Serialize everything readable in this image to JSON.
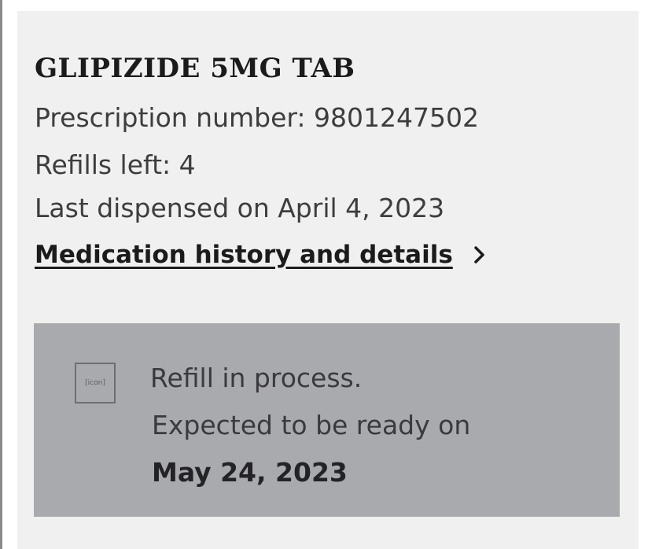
{
  "medication": {
    "name": "GLIPIZIDE 5MG TAB",
    "prescription_number": "Prescription number: 9801247502",
    "refills_left": "Refills left: 4",
    "last_dispensed": "Last dispensed on April 4, 2023",
    "history_link_label": "Medication history and details"
  },
  "refill_status": {
    "icon_placeholder": "[icon]",
    "icon_name": "refill-status-icon",
    "line1": "Refill in process.",
    "line2": "Expected to be ready on",
    "ready_date": "May 24, 2023"
  },
  "colors": {
    "card_background": "#f0f0f0",
    "alert_background": "#a9aaae",
    "text_primary": "#1b1b1b"
  }
}
